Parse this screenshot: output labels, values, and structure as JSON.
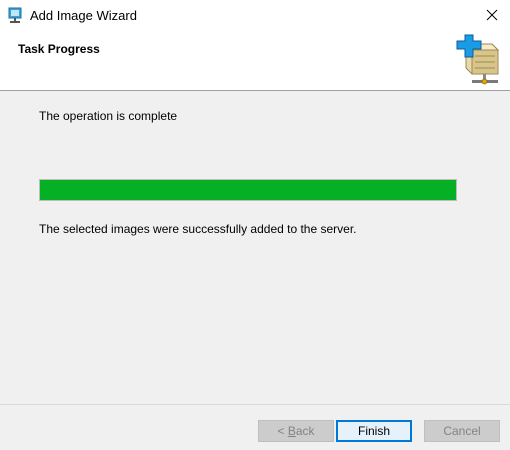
{
  "window": {
    "title": "Add Image Wizard",
    "icon": "wds-server-icon",
    "close_icon": "close-icon"
  },
  "header": {
    "title": "Task Progress",
    "icon": "server-add-icon",
    "accent_color": "#0a8fe0"
  },
  "main": {
    "status_label": "The operation is complete",
    "progress": {
      "percent": 100,
      "fill_color": "#06b025"
    },
    "result_message": "The selected images were successfully added to the server."
  },
  "footer": {
    "back": {
      "label_prefix": "< ",
      "label_access_key": "B",
      "label_rest": "ack",
      "enabled": false
    },
    "finish": {
      "label": "Finish",
      "enabled": true,
      "default": true
    },
    "cancel": {
      "label": "Cancel",
      "enabled": false
    }
  }
}
